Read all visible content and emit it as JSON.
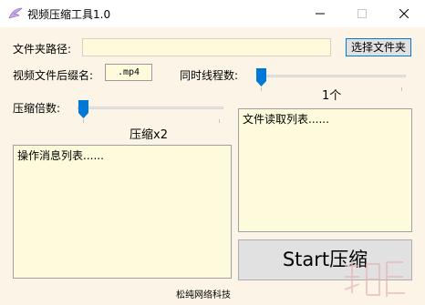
{
  "window": {
    "title": "视频压缩工具1.0",
    "icons": {
      "app": "wing-icon",
      "minimize": "minimize-icon",
      "maximize": "maximize-icon",
      "close": "close-icon"
    }
  },
  "folder": {
    "label": "文件夹路径:",
    "value": "",
    "select_button": "选择文件夹"
  },
  "extension": {
    "label": "视频文件后缀名:",
    "value": ".mp4"
  },
  "threads": {
    "label": "同时线程数:",
    "value_text": "1个",
    "level": 0
  },
  "compression": {
    "label": "压缩倍数:",
    "value_text": "压缩x2",
    "level": 0
  },
  "message_list": {
    "header": "操作消息列表......"
  },
  "file_list": {
    "header": "文件读取列表......"
  },
  "start_button": "Start压缩",
  "footer": "松纯网络科技",
  "colors": {
    "background": "#fcf5e7",
    "input_bg": "#fdfbdc",
    "accent": "#0078d7"
  }
}
